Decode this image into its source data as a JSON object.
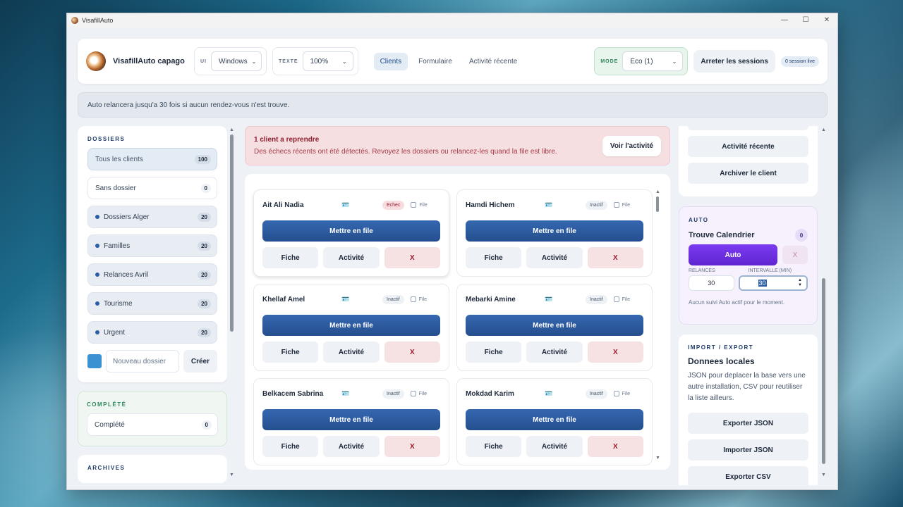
{
  "app": {
    "title": "VisafillAuto",
    "brand": "VisafillAuto capago"
  },
  "header": {
    "ui_label": "UI",
    "ui_value": "Windows",
    "text_label": "TEXTE",
    "text_value": "100%",
    "tabs": [
      {
        "label": "Clients"
      },
      {
        "label": "Formulaire"
      },
      {
        "label": "Activité récente"
      }
    ],
    "mode_label": "MODE",
    "mode_value": "Eco (1)",
    "stop_label": "Arreter les sessions",
    "live_label": "0 session live"
  },
  "banner": "Auto relancera jusqu'a 30 fois si aucun rendez-vous n'est trouve.",
  "sidebar": {
    "title": "DOSSIERS",
    "all": {
      "label": "Tous les clients",
      "count": "100"
    },
    "none": {
      "label": "Sans dossier",
      "count": "0"
    },
    "folders": [
      {
        "label": "Dossiers Alger",
        "count": "20"
      },
      {
        "label": "Familles",
        "count": "20"
      },
      {
        "label": "Relances Avril",
        "count": "20"
      },
      {
        "label": "Tourisme",
        "count": "20"
      },
      {
        "label": "Urgent",
        "count": "20"
      }
    ],
    "new_placeholder": "Nouveau dossier",
    "create_label": "Créer",
    "completed_title": "COMPLÉTÉ",
    "completed": {
      "label": "Complété",
      "count": "0"
    },
    "archives_title": "ARCHIVES"
  },
  "alert": {
    "title": "1 client a reprendre",
    "text": "Des échecs récents ont été détectés. Revoyez les dossiers ou relancez-les quand la file est libre.",
    "button": "Voir l'activité"
  },
  "clients": [
    {
      "name": "Ait Ali Nadia",
      "status": "Echec"
    },
    {
      "name": "Hamdi Hichem",
      "status": "Inactif"
    },
    {
      "name": "Khellaf Amel",
      "status": "Inactif"
    },
    {
      "name": "Mebarki Amine",
      "status": "Inactif"
    },
    {
      "name": "Belkacem Sabrina",
      "status": "Inactif"
    },
    {
      "name": "Mokdad Karim",
      "status": "Inactif"
    }
  ],
  "client_labels": {
    "file": "File",
    "put": "Mettre en file",
    "fiche": "Fiche",
    "activite": "Activité",
    "remove": "X"
  },
  "right": {
    "recent_label": "Activité récente",
    "archive_label": "Archiver le client",
    "auto_title": "AUTO",
    "auto_name": "Trouve Calendrier",
    "auto_count": "0",
    "auto_button": "Auto",
    "auto_x": "X",
    "relances_label": "RELANCES",
    "interval_label": "INTERVALLE (MIN)",
    "relances_value": "30",
    "interval_value": "30",
    "auto_note": "Aucun suivi Auto actif pour le moment.",
    "import_title": "IMPORT / EXPORT",
    "import_heading": "Donnees locales",
    "import_desc": "JSON pour deplacer la base vers une autre installation, CSV pour reutiliser la liste ailleurs.",
    "export_json": "Exporter JSON",
    "import_json": "Importer JSON",
    "export_csv": "Exporter CSV"
  }
}
